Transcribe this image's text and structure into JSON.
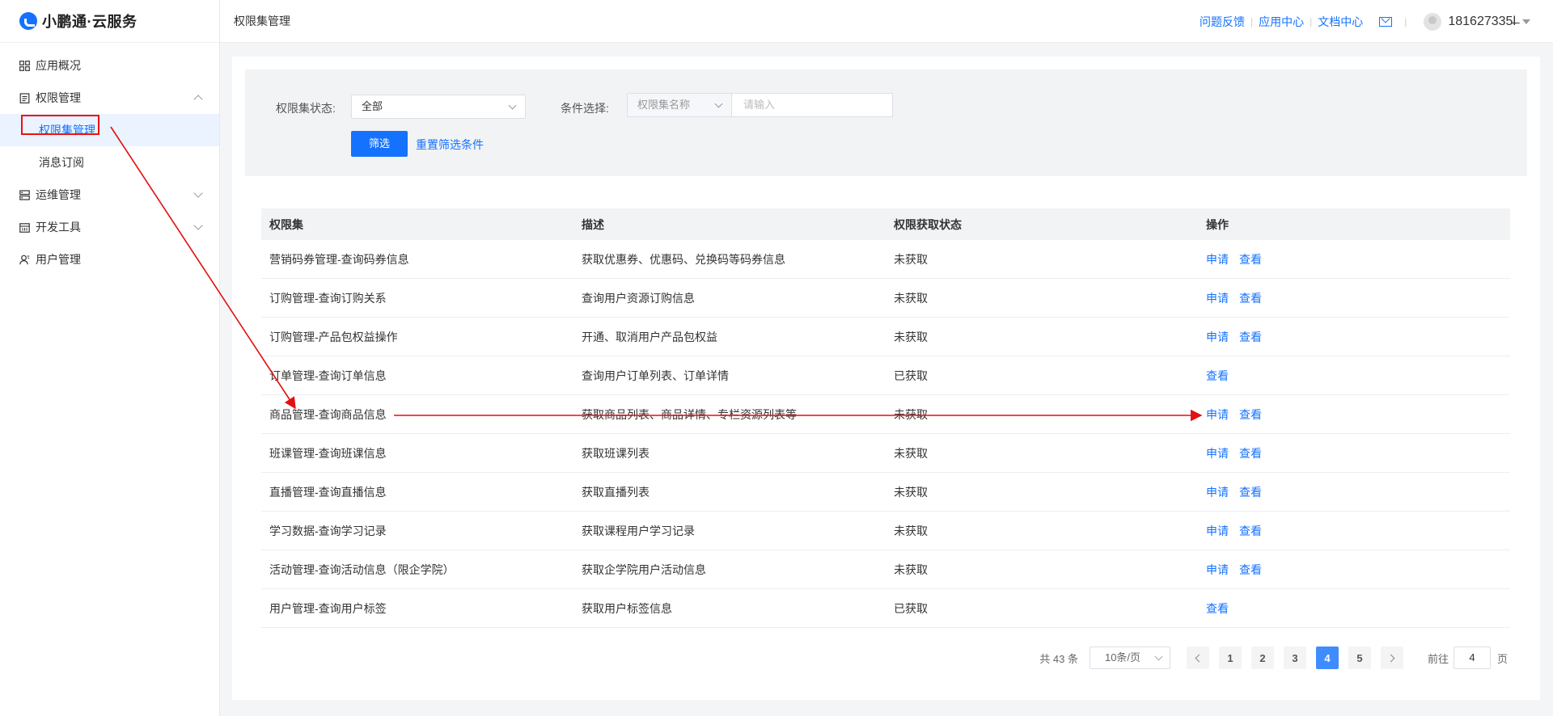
{
  "app": {
    "logo_text": "小鹏通·云服务",
    "page_title": "权限集管理"
  },
  "header": {
    "links": [
      "问题反馈",
      "应用中心",
      "文档中心"
    ],
    "separator": "|",
    "username": "18162733  ",
    "username_display": "181627335l̶"
  },
  "sidebar": {
    "items": [
      {
        "label": "应用概况",
        "icon": "grid-icon"
      },
      {
        "label": "权限管理",
        "icon": "document-icon",
        "expanded": true,
        "children": [
          {
            "label": "权限集管理",
            "active": true
          },
          {
            "label": "消息订阅",
            "active": false
          }
        ]
      },
      {
        "label": "运维管理",
        "icon": "server-icon"
      },
      {
        "label": "开发工具",
        "icon": "calendar-icon"
      },
      {
        "label": "用户管理",
        "icon": "user-icon"
      }
    ]
  },
  "filter": {
    "status_label": "权限集状态:",
    "status_value": "全部",
    "condition_label": "条件选择:",
    "condition_field": "权限集名称",
    "condition_placeholder": "请输入",
    "submit_label": "筛选",
    "reset_label": "重置筛选条件"
  },
  "table": {
    "columns": [
      "权限集",
      "描述",
      "权限获取状态",
      "操作"
    ],
    "rows": [
      {
        "name": "营销码券管理-查询码券信息",
        "desc": "获取优惠券、优惠码、兑换码等码券信息",
        "status": "未获取",
        "actions": [
          "申请",
          "查看"
        ]
      },
      {
        "name": "订购管理-查询订购关系",
        "desc": "查询用户资源订购信息",
        "status": "未获取",
        "actions": [
          "申请",
          "查看"
        ]
      },
      {
        "name": "订购管理-产品包权益操作",
        "desc": "开通、取消用户产品包权益",
        "status": "未获取",
        "actions": [
          "申请",
          "查看"
        ]
      },
      {
        "name": "订单管理-查询订单信息",
        "desc": "查询用户订单列表、订单详情",
        "status": "已获取",
        "actions": [
          "查看"
        ]
      },
      {
        "name": "商品管理-查询商品信息",
        "desc": "获取商品列表、商品详情、专栏资源列表等",
        "status": "未获取",
        "actions": [
          "申请",
          "查看"
        ]
      },
      {
        "name": "班课管理-查询班课信息",
        "desc": "获取班课列表",
        "status": "未获取",
        "actions": [
          "申请",
          "查看"
        ]
      },
      {
        "name": "直播管理-查询直播信息",
        "desc": "获取直播列表",
        "status": "未获取",
        "actions": [
          "申请",
          "查看"
        ]
      },
      {
        "name": "学习数据-查询学习记录",
        "desc": "获取课程用户学习记录",
        "status": "未获取",
        "actions": [
          "申请",
          "查看"
        ]
      },
      {
        "name": "活动管理-查询活动信息（限企学院）",
        "desc": "获取企学院用户活动信息",
        "status": "未获取",
        "actions": [
          "申请",
          "查看"
        ]
      },
      {
        "name": "用户管理-查询用户标签",
        "desc": "获取用户标签信息",
        "status": "已获取",
        "actions": [
          "查看"
        ]
      }
    ]
  },
  "pagination": {
    "total_text": "共 43 条",
    "page_size": "10条/页",
    "pages": [
      "1",
      "2",
      "3",
      "4",
      "5"
    ],
    "current_page": "4",
    "goto_label": "前往",
    "goto_value": "4",
    "goto_suffix": "页"
  },
  "colors": {
    "accent": "#1472ff",
    "annotation": "#e11111"
  }
}
